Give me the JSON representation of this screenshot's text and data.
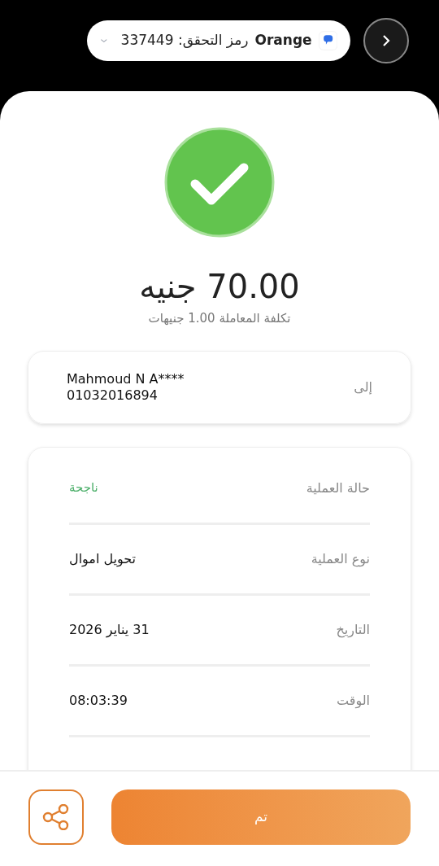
{
  "notification": {
    "sender": "Orange",
    "message": "رمز التحقق: 337449"
  },
  "amount": "70.00 جنيه",
  "fee": "تكلفة المعاملة 1.00 جنيهات",
  "recipient": {
    "label": "إلى",
    "name": "Mahmoud N A****",
    "phone": "01032016894"
  },
  "details": [
    {
      "kind": "status",
      "label": "حالة العملية",
      "value": "ناجحة"
    },
    {
      "kind": "text",
      "label": "نوع العملية",
      "value": "تحويل اموال"
    },
    {
      "kind": "text",
      "label": "التاريخ",
      "value": "31 يناير 2026"
    },
    {
      "kind": "text",
      "label": "الوقت",
      "value": "08:03:39"
    }
  ],
  "done_button": "تم"
}
